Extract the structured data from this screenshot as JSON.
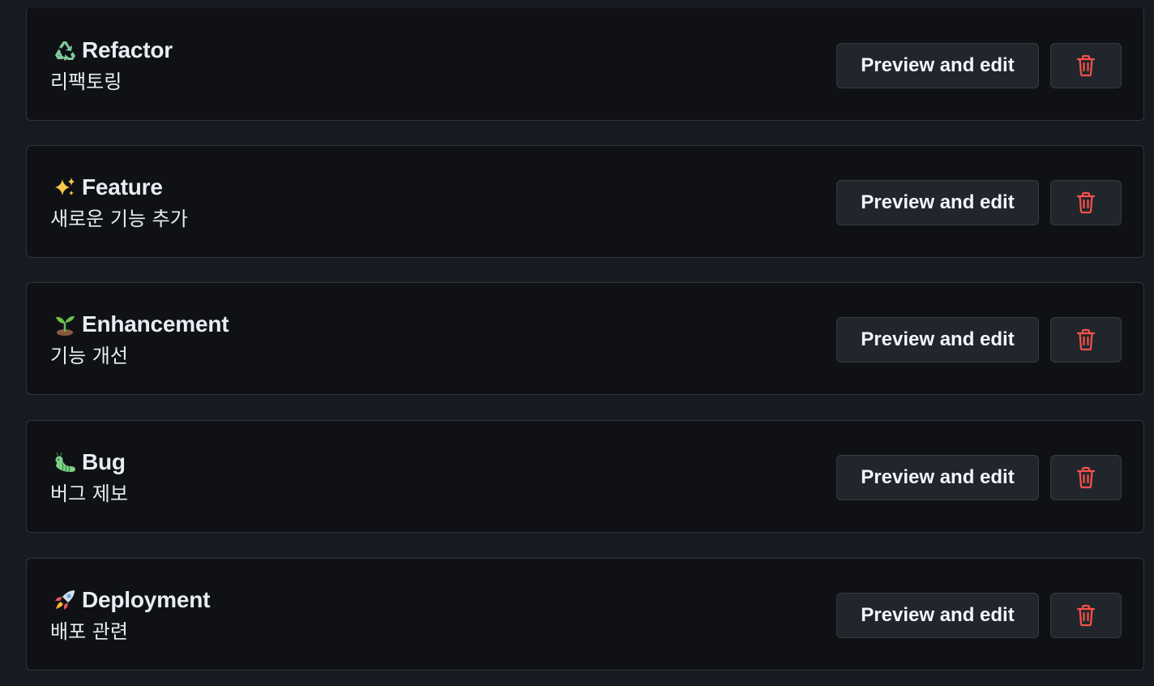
{
  "labels": [
    {
      "emoji_name": "recycle-icon",
      "title": "Refactor",
      "description": "리팩토링",
      "preview_label": "Preview and edit"
    },
    {
      "emoji_name": "sparkles-icon",
      "title": "Feature",
      "description": "새로운 기능 추가",
      "preview_label": "Preview and edit"
    },
    {
      "emoji_name": "seedling-icon",
      "title": "Enhancement",
      "description": "기능 개선",
      "preview_label": "Preview and edit"
    },
    {
      "emoji_name": "bug-icon",
      "title": "Bug",
      "description": "버그 제보",
      "preview_label": "Preview and edit"
    },
    {
      "emoji_name": "rocket-icon",
      "title": "Deployment",
      "description": "배포 관련",
      "preview_label": "Preview and edit"
    }
  ],
  "colors": {
    "page_bg": "#161b22",
    "card_bg": "#0f1115",
    "card_border": "#30363d",
    "button_bg": "#21262d",
    "text": "#e6edf3",
    "danger": "#f85149"
  }
}
